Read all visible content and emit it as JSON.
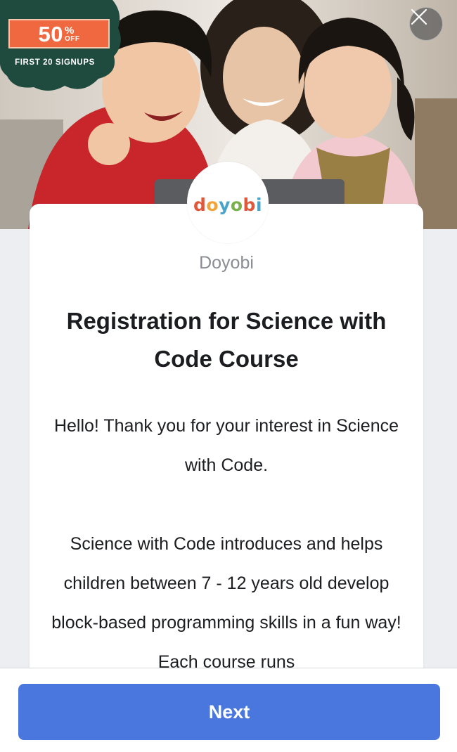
{
  "promo": {
    "discount": "50",
    "percent_sign": "%",
    "off_label": "OFF",
    "signups_label": "FIRST 20 SIGNUPS"
  },
  "logo": {
    "letters": [
      "d",
      "o",
      "y",
      "o",
      "b",
      "i"
    ],
    "letter_colors": [
      "#e0573a",
      "#f2a33a",
      "#4aa3c9",
      "#7bb04a",
      "#e0573a",
      "#4aa3c9"
    ]
  },
  "org_name": "Doyobi",
  "form": {
    "title": "Registration for Science with Code Course",
    "paragraph_1": "Hello! Thank you for your interest in Science with Code.",
    "paragraph_2": "Science with Code introduces and helps children between 7 - 12 years old develop block-based programming skills in a fun way! Each course runs"
  },
  "footer": {
    "next_label": "Next"
  },
  "colors": {
    "primary_button": "#4a77de",
    "promo_badge": "#1f4a3e",
    "promo_accent": "#f0683f",
    "background": "#edeef2"
  },
  "icons": {
    "close": "close-icon"
  }
}
